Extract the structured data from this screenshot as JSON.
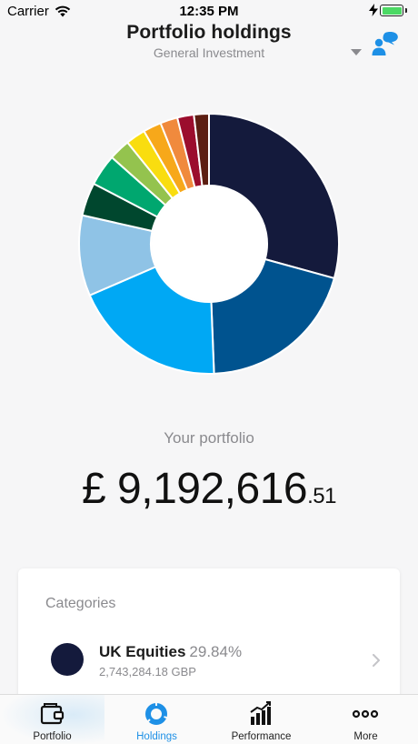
{
  "status_bar": {
    "carrier": "Carrier",
    "time": "12:35 PM"
  },
  "header": {
    "title": "Portfolio holdings",
    "subtitle": "General Investment",
    "chat_icon": "chat-bubbles-icon",
    "dropdown_icon": "triangle-down-icon"
  },
  "donut": {
    "slices": [
      {
        "value": 29.84,
        "color": "#141a3c"
      },
      {
        "value": 20.5,
        "color": "#00538f"
      },
      {
        "value": 19.5,
        "color": "#00a8f4"
      },
      {
        "value": 10.2,
        "color": "#8fc3e6"
      },
      {
        "value": 4.2,
        "color": "#00472e"
      },
      {
        "value": 4.0,
        "color": "#00a76f"
      },
      {
        "value": 2.7,
        "color": "#94c34e"
      },
      {
        "value": 2.5,
        "color": "#f9dd0f"
      },
      {
        "value": 2.3,
        "color": "#f7a81a"
      },
      {
        "value": 2.2,
        "color": "#f08a3d"
      },
      {
        "value": 2.1,
        "color": "#9b0d2d"
      },
      {
        "value": 1.9,
        "color": "#5c1e12"
      }
    ]
  },
  "portfolio": {
    "label": "Your portfolio",
    "value_main": "£ 9,192,616",
    "value_pence": ".51"
  },
  "categories": {
    "title": "Categories",
    "items": [
      {
        "name": "UK Equities",
        "percent": "29.84%",
        "amount": "2,743,284.18 GBP",
        "color": "#141a3c"
      }
    ]
  },
  "tabs": [
    {
      "label": "Portfolio",
      "icon": "wallet-icon",
      "active": false
    },
    {
      "label": "Holdings",
      "icon": "donut-chart-icon",
      "active": true
    },
    {
      "label": "Performance",
      "icon": "bar-chart-icon",
      "active": false
    },
    {
      "label": "More",
      "icon": "more-dots-icon",
      "active": false
    }
  ],
  "colors": {
    "accent": "#1e90e6",
    "muted_text": "#8a8a8e"
  }
}
